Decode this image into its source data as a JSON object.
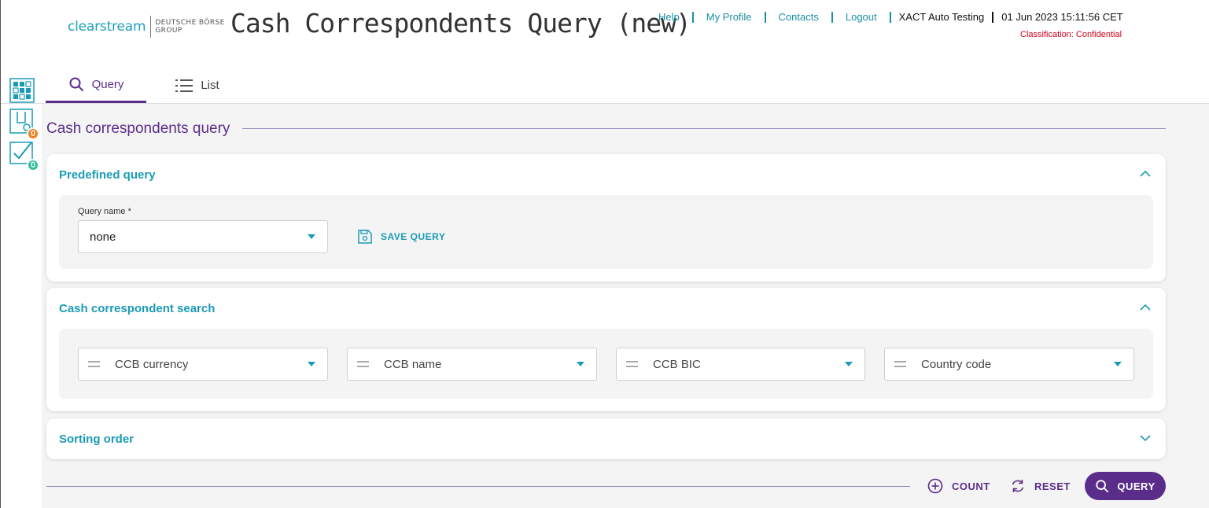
{
  "header": {
    "logo_main": "clearstream",
    "logo_sub_line1": "DEUTSCHE BÖRSE",
    "logo_sub_line2": "GROUP",
    "title": "Cash Correspondents Query (new)",
    "nav": [
      {
        "label": "Help"
      },
      {
        "label": "My Profile"
      },
      {
        "label": "Contacts"
      },
      {
        "label": "Logout"
      }
    ],
    "user": "XACT Auto Testing",
    "datetime": "01 Jun 2023 15:11:56 CET",
    "classification": "Classification: Confidential"
  },
  "tabs": [
    {
      "label": "Query",
      "icon": "search-icon",
      "active": true
    },
    {
      "label": "List",
      "icon": "list-icon",
      "active": false
    }
  ],
  "rail": {
    "items": [
      {
        "icon": "app-grid-icon"
      },
      {
        "icon": "pending-tasks-icon",
        "badge": "0",
        "badge_color": "#f07e1b"
      },
      {
        "icon": "approvals-icon",
        "badge": "0",
        "badge_color": "#2bbf9e"
      }
    ]
  },
  "main": {
    "section_title": "Cash correspondents query",
    "predefined": {
      "title": "Predefined query",
      "query_name_label": "Query name *",
      "query_name_value": "none",
      "save_label": "SAVE QUERY"
    },
    "search": {
      "title": "Cash correspondent search",
      "criteria": [
        "CCB currency",
        "CCB name",
        "CCB BIC",
        "Country code"
      ]
    },
    "sorting": {
      "title": "Sorting order"
    }
  },
  "actions": {
    "count_label": "COUNT",
    "reset_label": "RESET",
    "query_label": "QUERY"
  },
  "colors": {
    "accent_purple": "#5b2d8a",
    "accent_teal": "#1a9bb5",
    "classification_red": "#d0021b"
  }
}
